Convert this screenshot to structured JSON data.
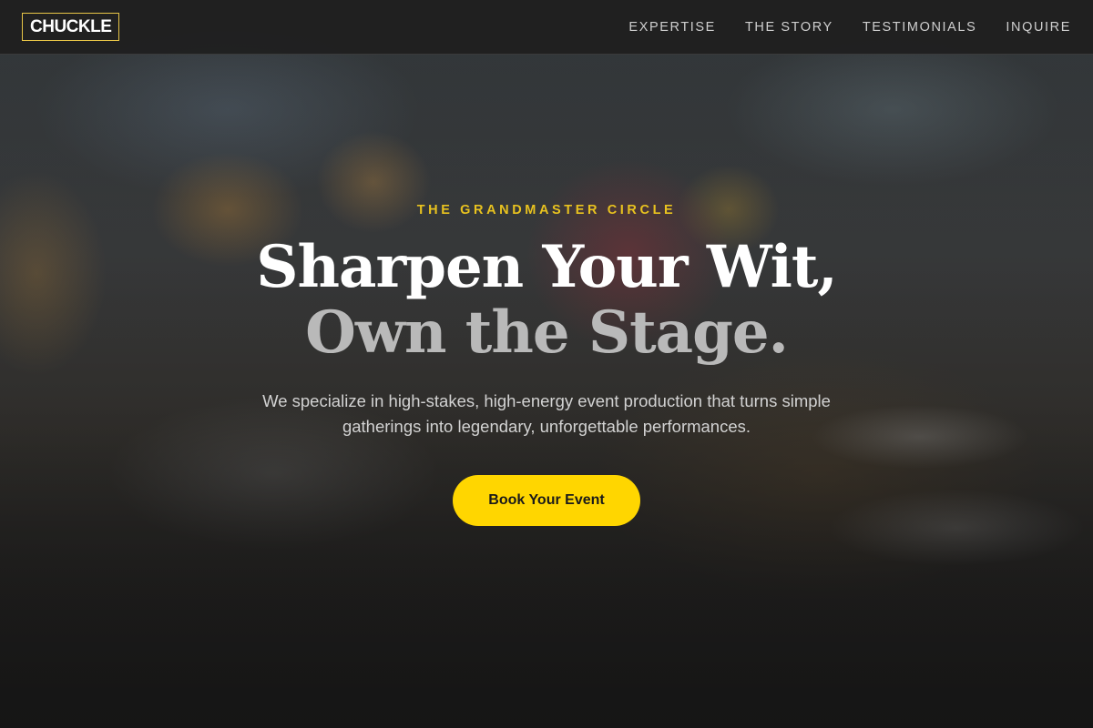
{
  "nav": {
    "logo": "CHUCKLE",
    "links": [
      "EXPERTISE",
      "THE STORY",
      "TESTIMONIALS",
      "INQUIRE"
    ]
  },
  "hero": {
    "eyebrow": "THE GRANDMASTER CIRCLE",
    "headline_line1": "Sharpen Your Wit,",
    "headline_line2": "Own the Stage.",
    "subtext": "We specialize in high-stakes, high-energy event production that turns simple gatherings into legendary, unforgettable performances.",
    "cta_label": "Book Your Event"
  },
  "colors": {
    "accent": "#ffd600",
    "eyebrow": "#e8c21f",
    "logo_border": "#e8c547",
    "nav_bg": "#1e1e1e"
  }
}
